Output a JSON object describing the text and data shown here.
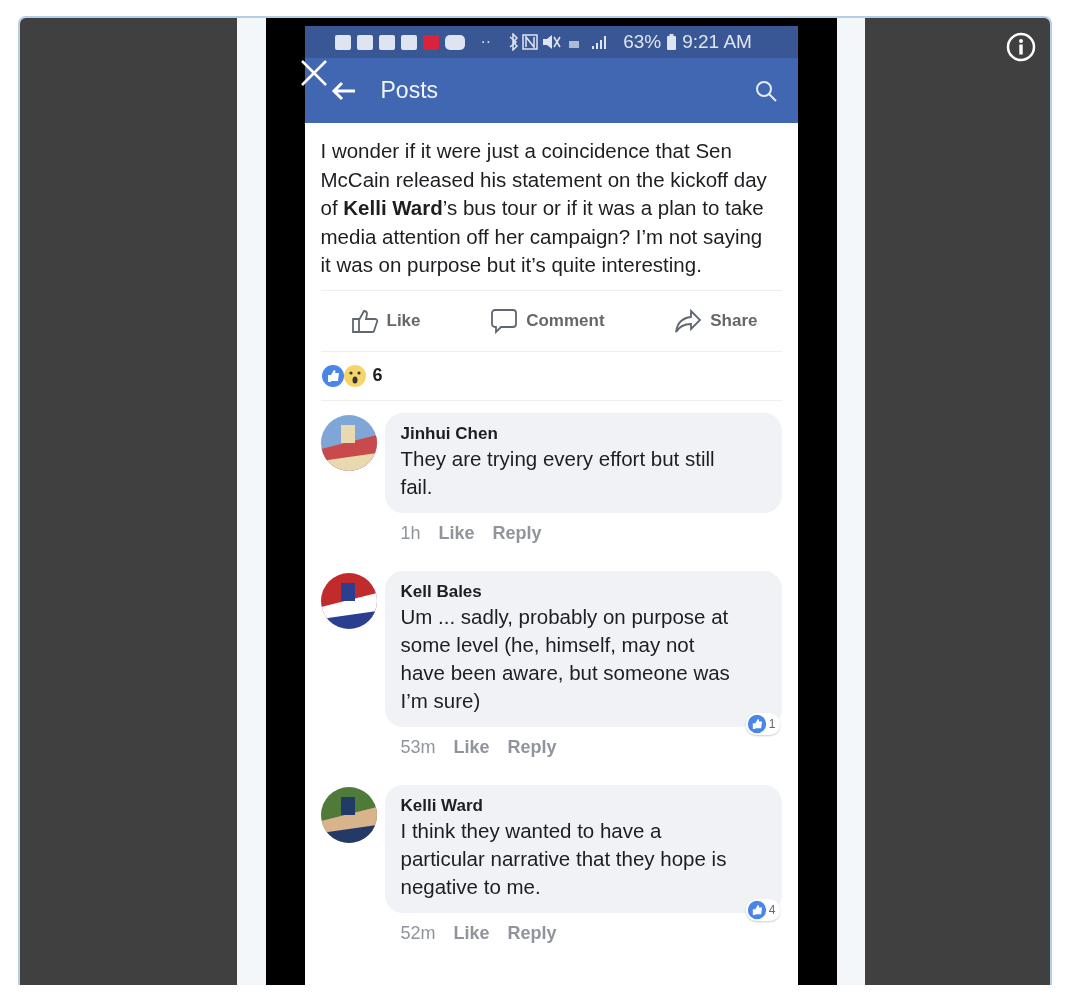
{
  "status_bar": {
    "more": "··",
    "battery": "63%",
    "time": "9:21 AM"
  },
  "header": {
    "title": "Posts"
  },
  "post": {
    "text": "I wonder if it were just a coincidence that Sen McCain released his statement on the kickoff day of **Kelli Ward**’s bus tour or if it was a plan to take media attention off her campaign? I’m not saying it was on purpose but it’s quite interesting.",
    "actions": [
      {
        "kind": "like",
        "label": "Like"
      },
      {
        "kind": "comment",
        "label": "Comment"
      },
      {
        "kind": "share",
        "label": "Share"
      }
    ],
    "reaction_count": "6"
  },
  "comments": [
    {
      "name": "Jinhui Chen",
      "text": "They are trying every effort but still fail.",
      "time": "1h",
      "like": "Like",
      "reply": "Reply"
    },
    {
      "name": "Kell Bales",
      "text": "Um ... sadly, probably on purpose at some level (he, himself, may not have been aware, but someone was I’m sure)",
      "time": "53m",
      "like": "Like",
      "reply": "Reply",
      "reactions": "1"
    },
    {
      "name": "Kelli Ward",
      "text": "I think they wanted to have a particular narrative that they hope is negative to me.",
      "time": "52m",
      "like": "Like",
      "reply": "Reply",
      "reactions": "4"
    }
  ]
}
